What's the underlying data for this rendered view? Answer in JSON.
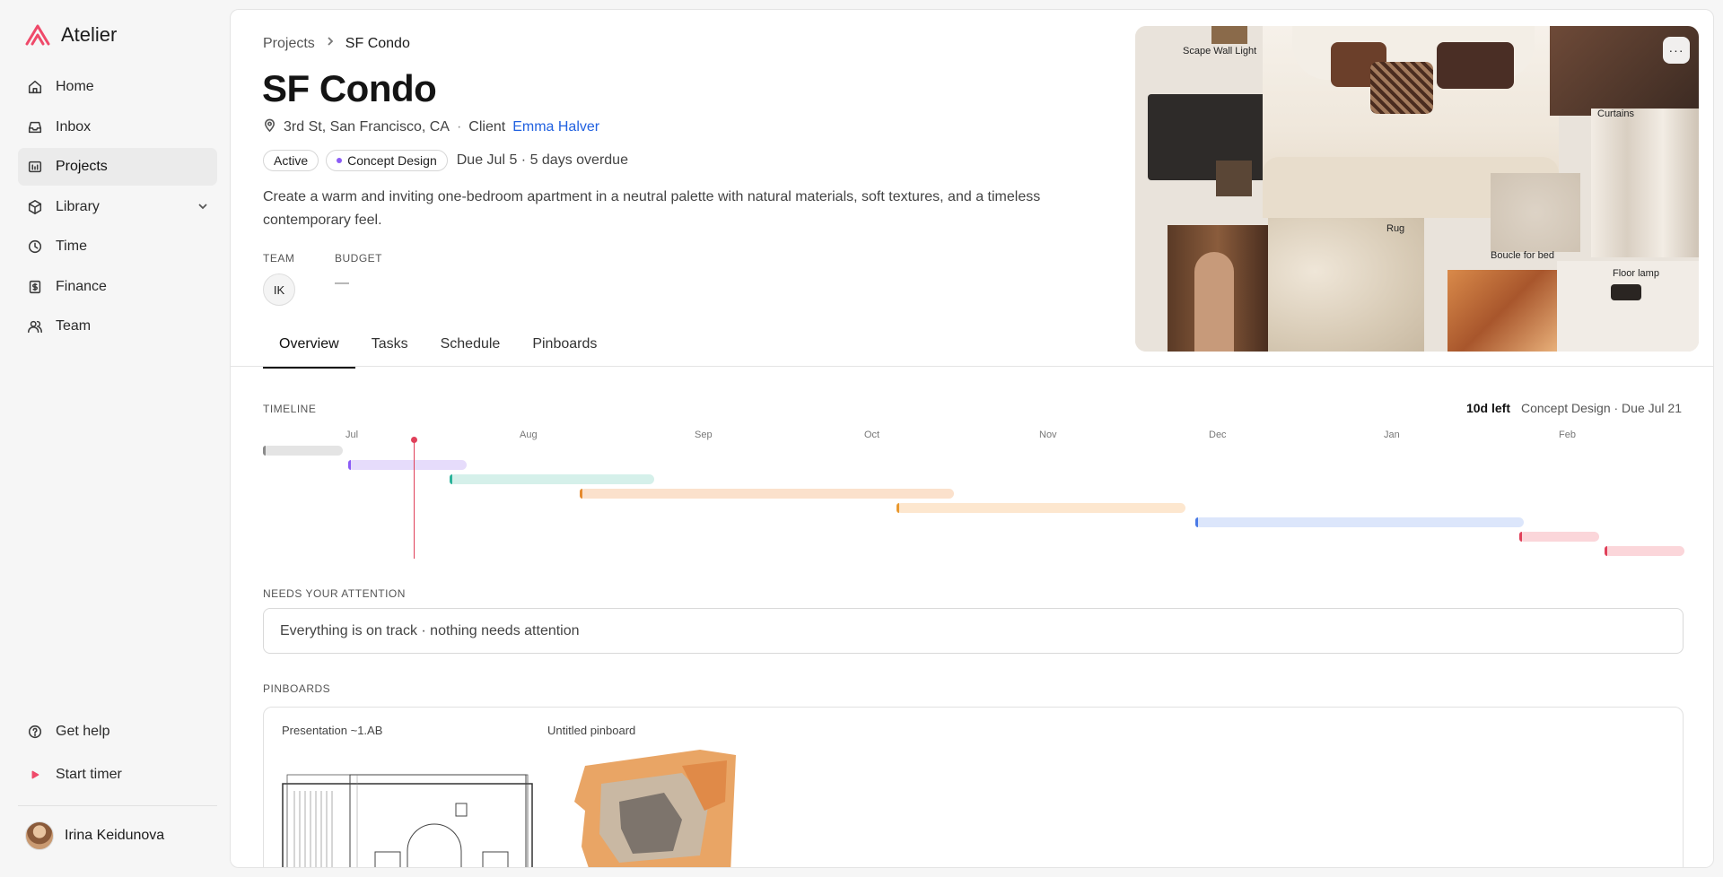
{
  "app": {
    "name": "Atelier",
    "accent": "#ef4a6a"
  },
  "sidebar": {
    "items": [
      {
        "label": "Home",
        "icon": "home-icon"
      },
      {
        "label": "Inbox",
        "icon": "inbox-icon"
      },
      {
        "label": "Projects",
        "icon": "projects-icon",
        "active": true
      },
      {
        "label": "Library",
        "icon": "library-icon",
        "expandable": true
      },
      {
        "label": "Time",
        "icon": "clock-icon"
      },
      {
        "label": "Finance",
        "icon": "finance-icon"
      },
      {
        "label": "Team",
        "icon": "team-icon"
      }
    ],
    "help_label": "Get help",
    "timer_label": "Start timer",
    "user_name": "Irina Keidunova"
  },
  "project": {
    "breadcrumb_parent": "Projects",
    "breadcrumb_current": "SF Condo",
    "title": "SF Condo",
    "address": "3rd St, San Francisco, CA",
    "client_label": "Client",
    "client_name": "Emma Halver",
    "status_badge": "Active",
    "phase_badge": "Concept Design",
    "due_text": "Due Jul 5 · 5 days overdue",
    "description": "Create a warm and inviting one-bedroom apartment in a neutral palette with natural materials, soft textures, and a timeless contemporary feel.",
    "team_label": "TEAM",
    "team_initials": "IK",
    "budget_label": "BUDGET",
    "budget_value": "—"
  },
  "tabs": [
    {
      "label": "Overview",
      "active": true
    },
    {
      "label": "Tasks"
    },
    {
      "label": "Schedule"
    },
    {
      "label": "Pinboards"
    }
  ],
  "moodboard": {
    "labels": [
      "Scape Wall Light",
      "Curtains",
      "Rug",
      "Boucle for bed",
      "Floor lamp"
    ],
    "more_label": "···"
  },
  "timeline": {
    "label": "TIMELINE",
    "days_left": "10d left",
    "current_phase": "Concept Design · Due Jul 21",
    "months": [
      "Jul",
      "Aug",
      "Sep",
      "Oct",
      "Nov",
      "Dec",
      "Jan",
      "Feb"
    ],
    "today_fraction": 0.106,
    "phases": [
      {
        "start": 0.0,
        "end": 0.056,
        "fill": "#e4e4e4",
        "edge": "#8a8a8a"
      },
      {
        "start": 0.06,
        "end": 0.143,
        "fill": "#e6dcfb",
        "edge": "#8b5cf6"
      },
      {
        "start": 0.131,
        "end": 0.275,
        "fill": "#d5f0ea",
        "edge": "#2bb39a"
      },
      {
        "start": 0.223,
        "end": 0.486,
        "fill": "#fbe1cc",
        "edge": "#e58a2e"
      },
      {
        "start": 0.446,
        "end": 0.649,
        "fill": "#fde7cf",
        "edge": "#e9992f"
      },
      {
        "start": 0.656,
        "end": 0.887,
        "fill": "#dce6fb",
        "edge": "#4a7ae6"
      },
      {
        "start": 0.884,
        "end": 0.94,
        "fill": "#fbd6da",
        "edge": "#e0405a"
      },
      {
        "start": 0.944,
        "end": 1.0,
        "fill": "#fbd6da",
        "edge": "#e0405a"
      }
    ]
  },
  "attention": {
    "label": "NEEDS YOUR ATTENTION",
    "message": "Everything is on track · nothing needs attention"
  },
  "pinboards": {
    "label": "PINBOARDS",
    "items": [
      {
        "name": "Presentation ~1.AB"
      },
      {
        "name": "Untitled pinboard"
      }
    ]
  }
}
